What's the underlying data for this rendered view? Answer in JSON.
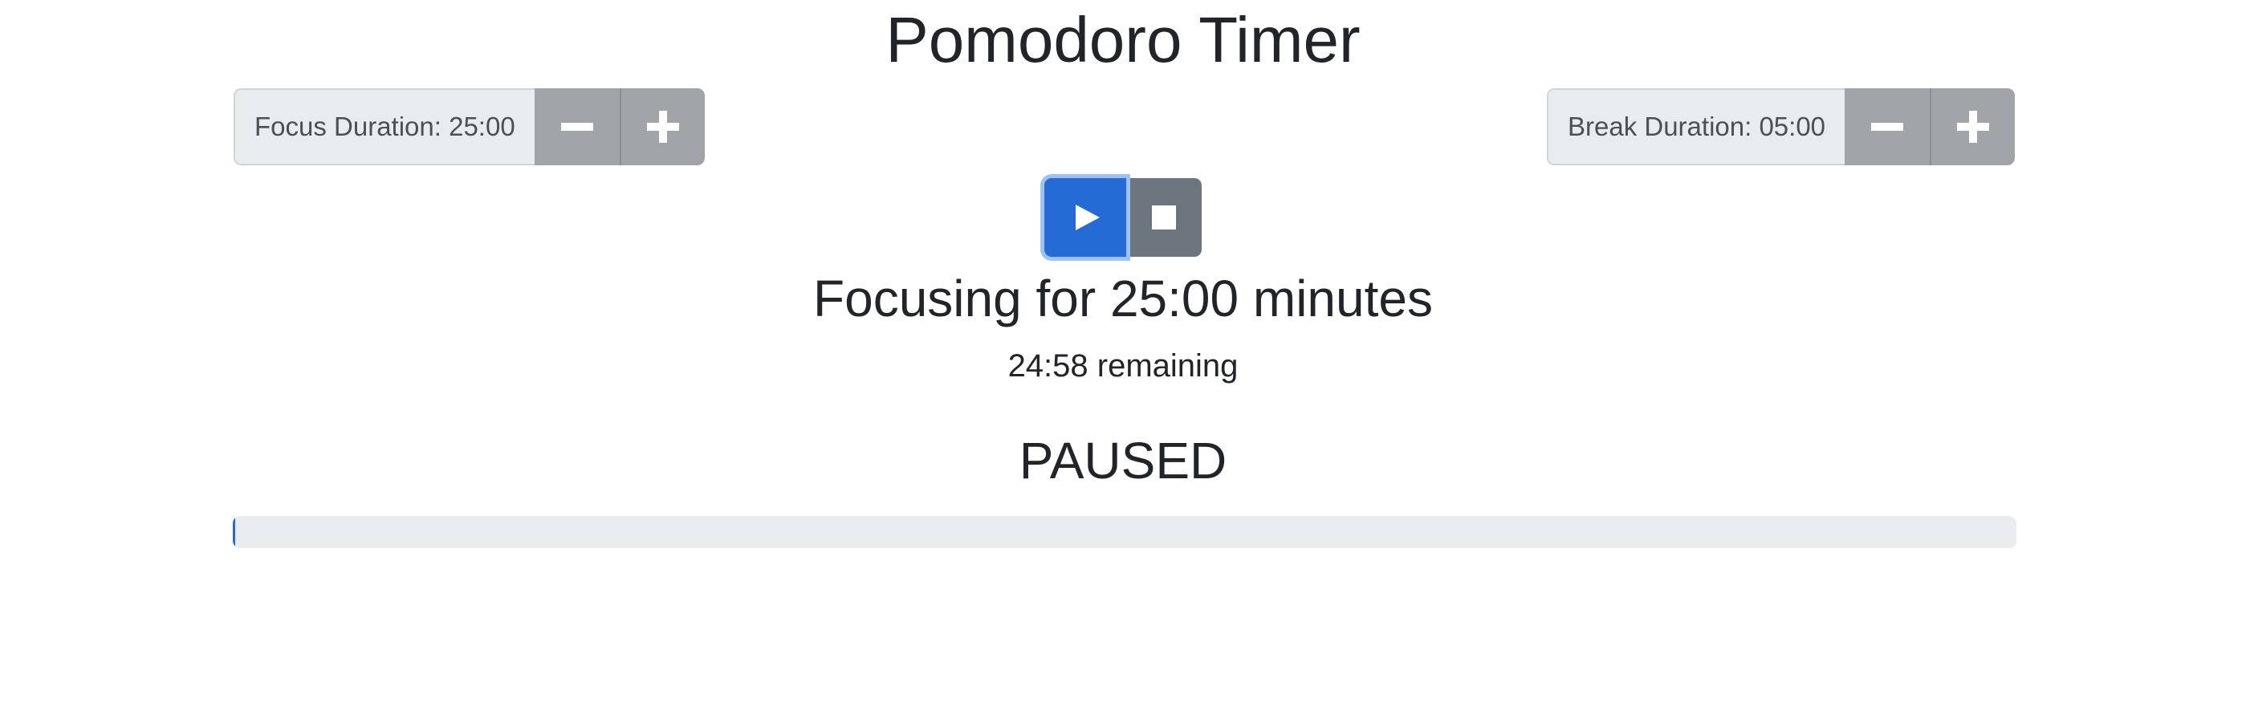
{
  "title": "Pomodoro Timer",
  "focus": {
    "label": "Focus Duration: 25:00",
    "decrement_icon": "minus-icon",
    "increment_icon": "plus-icon"
  },
  "break": {
    "label": "Break Duration: 05:00",
    "decrement_icon": "minus-icon",
    "increment_icon": "plus-icon"
  },
  "controls": {
    "play_icon": "play-icon",
    "stop_icon": "stop-icon"
  },
  "status": {
    "heading": "Focusing for 25:00 minutes",
    "remaining": "24:58 remaining",
    "state": "PAUSED"
  },
  "progress": {
    "fraction": 0.0013
  },
  "colors": {
    "primary": "#256bd6",
    "secondary": "#6c757d",
    "step_button": "#a1a5a9",
    "progress_track": "#e9ecef"
  }
}
